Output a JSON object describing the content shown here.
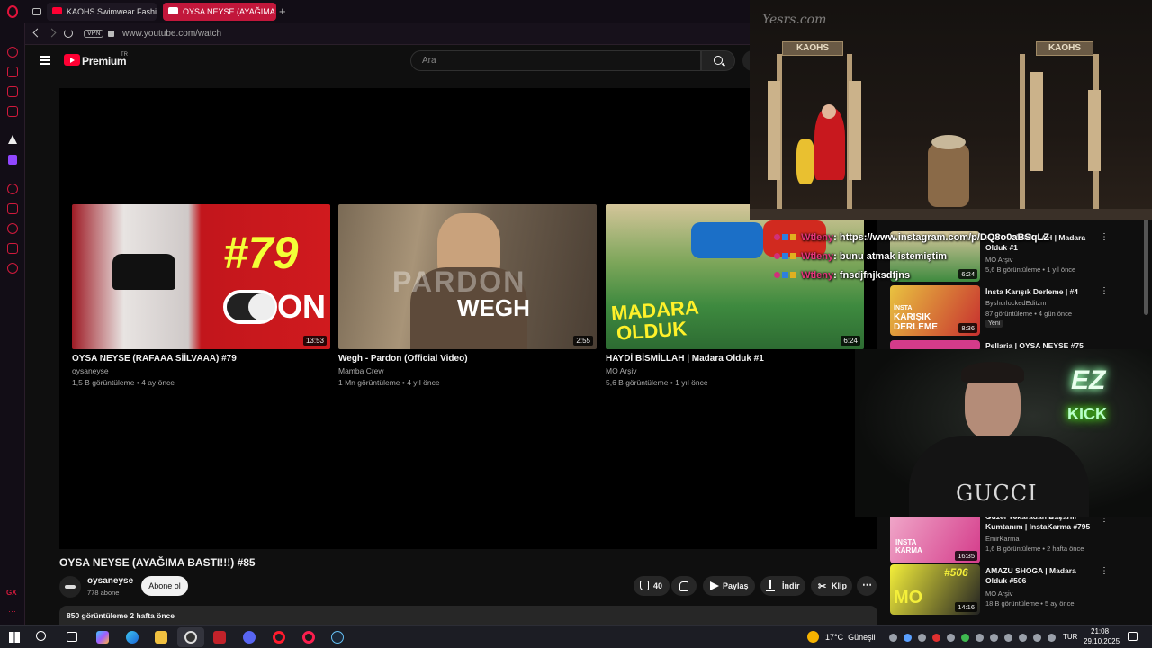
{
  "browser": {
    "tabs": [
      {
        "label": "KAOHS Swimwear Fashio"
      },
      {
        "label": "OYSA NEYSE (AYAĞIMA B"
      }
    ],
    "vpn_label": "VPN",
    "url": "www.youtube.com/watch"
  },
  "youtube": {
    "logo_text": "Premium",
    "logo_region": "TR",
    "search_placeholder": "Ara"
  },
  "endscreen": [
    {
      "title": "OYSA NEYSE (RAFAAA SİİLVAAA) #79",
      "channel": "oysaneyse",
      "meta": "1,5 B görüntüleme • 4 ay önce",
      "duration": "13:53",
      "overlay": "#79",
      "overlay2": "ON"
    },
    {
      "title": "Wegh - Pardon (Official Video)",
      "channel": "Mamba Crew",
      "meta": "1 Mn görüntüleme • 4 yıl önce",
      "duration": "2:55",
      "overlay": "PARDON",
      "overlay2": "WEGH"
    },
    {
      "title": "HAYDİ BİSMİLLAH | Madara Olduk #1",
      "channel": "MO Arşiv",
      "meta": "5,6 B görüntüleme • 1 yıl önce",
      "duration": "6:24",
      "overlay": "MADARA",
      "overlay2": "OLDUK"
    }
  ],
  "video": {
    "title": "OYSA NEYSE (AYAĞIMA BASTI!!!) #85",
    "channel": "oysaneyse",
    "subscribers": "778 abone",
    "subscribe_label": "Abone ol",
    "likes": "40",
    "share_label": "Paylaş",
    "download_label": "İndir",
    "clip_label": "Klip",
    "views_line": "850 görüntüleme  2 hafta önce"
  },
  "sidebar_list": [
    {
      "title": "HAYDİ BİSMİLLAH | Madara Olduk #1",
      "channel": "MO Arşiv",
      "meta": "5,6 B görüntüleme • 1 yıl önce",
      "duration": "6:24",
      "badge": ""
    },
    {
      "title": "İnsta Karışık Derleme | #4",
      "channel": "ByshcrlockedEditzm",
      "meta": "87 görüntüleme • 4 gün önce",
      "duration": "8:36",
      "badge": "Yeni"
    },
    {
      "title": "Pellaria | OYSA NEYSE #75",
      "channel": "",
      "meta": "",
      "duration": "",
      "badge": ""
    },
    {
      "title": "Güzel Yekaradan Başarılı Kumtanım | InstaKarma #795",
      "channel": "EmirKarma",
      "meta": "1,6 B görüntüleme • 2 hafta önce",
      "duration": "16:35",
      "badge": ""
    },
    {
      "title": "AMAZU SHOGA | Madara Olduk #506",
      "channel": "MO Arşiv",
      "meta": "18 B görüntüleme • 5 ay önce",
      "duration": "14:16",
      "badge": ""
    }
  ],
  "stream": {
    "watermark": "Yesrs.com",
    "sign_left": "KAOHS",
    "sign_right": "KAOHS",
    "neon_top": "EZ",
    "neon_bottom": "KICK",
    "shirt_text": "GUCCI"
  },
  "chat": [
    {
      "user": "Wtleny",
      "message": ": https://www.instagram.com/p/DQ8o0aBSqLZ"
    },
    {
      "user": "Wtleny",
      "message": ": bunu atmak istemiştim"
    },
    {
      "user": "Wtleny",
      "message": ": fnsdjfnjksdfjns"
    }
  ],
  "taskbar": {
    "weather": "17°C  Güneşli",
    "lang": "TUR",
    "time": "21:08",
    "date": "29.10.2025"
  },
  "colors": {
    "accent": "#ff0033",
    "opera_red": "#d11a3c",
    "chat_user": "#e2357a",
    "neon": "#a8ffbd"
  }
}
